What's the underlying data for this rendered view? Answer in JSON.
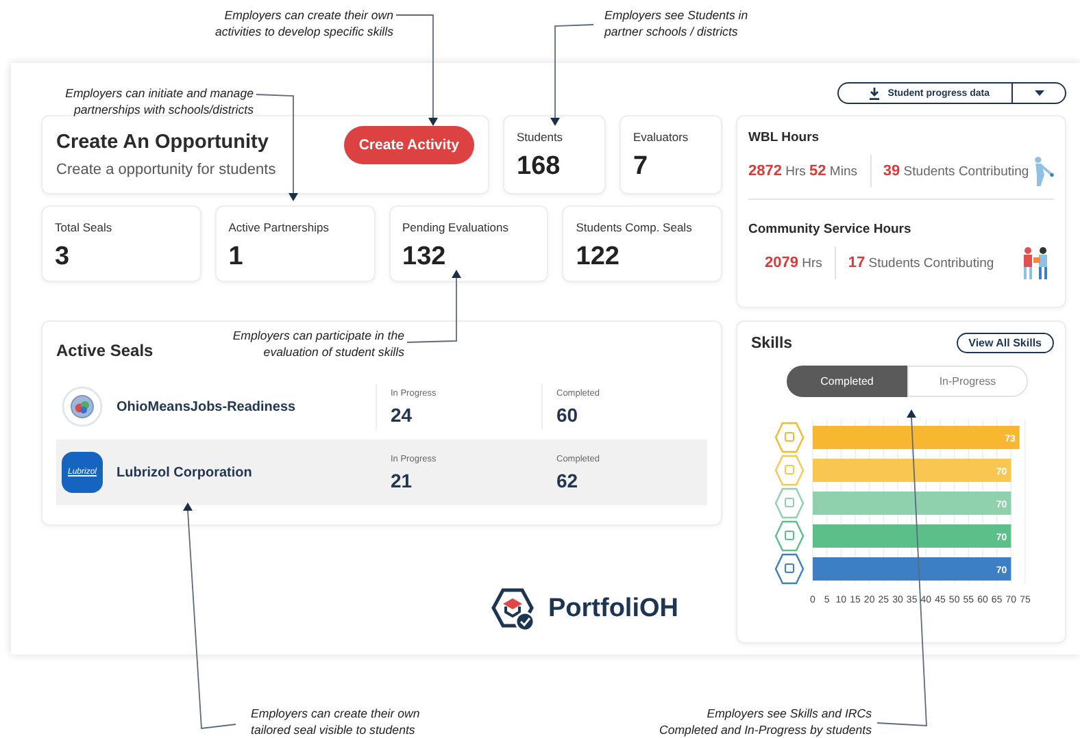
{
  "annotations": [
    {
      "text": "Employers can create their own\nactivities to develop specific skills"
    },
    {
      "text": "Employers see Students in\npartner schools / districts"
    },
    {
      "text": "Employers can initiate and manage\npartnerships with schools/districts"
    },
    {
      "text": "Employers can participate in the\nevaluation of student skills"
    },
    {
      "text": "Employers can create their own\ntailored seal visible to students"
    },
    {
      "text": "Employers see Skills and IRCs\nCompleted and In-Progress by students"
    }
  ],
  "download_button": {
    "label": "Student progress data"
  },
  "create_card": {
    "title": "Create An Opportunity",
    "subtitle": "Create a opportunity for students",
    "button": "Create Activity"
  },
  "top_stats": [
    {
      "label": "Students",
      "value": "168"
    },
    {
      "label": "Evaluators",
      "value": "7"
    }
  ],
  "stats": [
    {
      "label": "Total Seals",
      "value": "3"
    },
    {
      "label": "Active Partnerships",
      "value": "1"
    },
    {
      "label": "Pending Evaluations",
      "value": "132"
    },
    {
      "label": "Students Comp. Seals",
      "value": "122"
    }
  ],
  "active_seals": {
    "title": "Active Seals",
    "rows": [
      {
        "name": "OhioMeansJobs-Readiness",
        "kind": "ohio",
        "in_progress_label": "In Progress",
        "in_progress": "24",
        "completed_label": "Completed",
        "completed": "60",
        "selected": false
      },
      {
        "name": "Lubrizol Corporation",
        "kind": "lubrizol",
        "logo_text": "Lubrizol",
        "in_progress_label": "In Progress",
        "in_progress": "21",
        "completed_label": "Completed",
        "completed": "62",
        "selected": true
      }
    ]
  },
  "hours": [
    {
      "kind": "wbl",
      "title": "WBL Hours",
      "amount": "**2872** Hrs **52** Mins",
      "students": "**39** Students Contributing"
    },
    {
      "kind": "community",
      "title": "Community Service Hours",
      "amount": "**2079** Hrs",
      "students": "**17** Students Contributing"
    }
  ],
  "skills": {
    "title": "Skills",
    "view_all": "View All Skills",
    "tabs": [
      {
        "label": "Completed",
        "selected": true
      },
      {
        "label": "In-Progress",
        "selected": false
      }
    ],
    "chart_data": {
      "type": "bar",
      "orientation": "horizontal",
      "values": [
        73,
        70,
        70,
        70,
        70
      ],
      "colors": [
        "#f7b731",
        "#f9c74f",
        "#8fd0ad",
        "#5cbf8a",
        "#3c7fc4"
      ],
      "xlim": [
        0,
        75
      ],
      "xticks": [
        0,
        5,
        10,
        15,
        20,
        25,
        30,
        35,
        40,
        45,
        50,
        55,
        60,
        65,
        70,
        75
      ],
      "data_labels": true,
      "grid": true
    }
  },
  "brand": {
    "name": "PortfoliOH"
  }
}
